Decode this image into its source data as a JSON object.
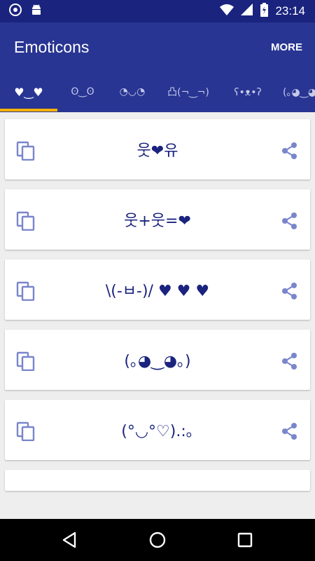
{
  "status_bar": {
    "time": "23:14",
    "left_icons": [
      "sync-icon",
      "android-icon"
    ],
    "right_icons": [
      "wifi-icon",
      "signal-icon",
      "battery-icon"
    ]
  },
  "app_bar": {
    "title": "Emoticons",
    "more_label": "MORE"
  },
  "tabs": [
    {
      "label": "♥‿♥",
      "active": true
    },
    {
      "label": "ʘ‿ʘ",
      "active": false
    },
    {
      "label": "◔◡◔",
      "active": false
    },
    {
      "label": "凸(¬‿¬)",
      "active": false
    },
    {
      "label": "ʕ•ᴥ•ʔ",
      "active": false
    },
    {
      "label": "(｡◕‿◕｡)",
      "active": false
    }
  ],
  "emoticons": [
    {
      "text": "웃❤유"
    },
    {
      "text": "웃+웃=❤"
    },
    {
      "text": "\\(-ㅂ-)/ ♥ ♥ ♥"
    },
    {
      "text": "(｡◕‿◕｡)"
    },
    {
      "text": "(°◡°♡).:｡"
    }
  ],
  "card_icons": {
    "copy": "copy-icon",
    "share": "share-icon"
  },
  "nav_bar": [
    "back-icon",
    "home-icon",
    "recents-icon"
  ],
  "colors": {
    "status_bar": "#1a237e",
    "primary": "#283593",
    "accent": "#ffb300",
    "emoticon_text": "#1a237e",
    "icon_tint": "#7986cb",
    "background": "#eeeeee"
  }
}
